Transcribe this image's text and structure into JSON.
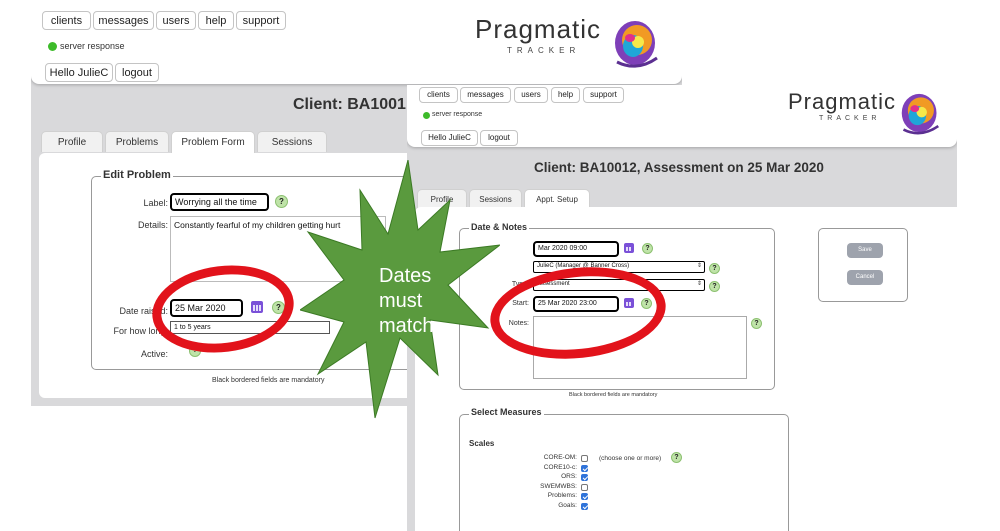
{
  "nav": {
    "clients": "clients",
    "messages": "messages",
    "users": "users",
    "help": "help",
    "support": "support",
    "hello": "Hello JulieC",
    "logout": "logout"
  },
  "status": {
    "server": "server response"
  },
  "logo": {
    "word": "Pragmatic",
    "sub": "TRACKER"
  },
  "win1": {
    "title": "Client: BA1001",
    "tabs": [
      "Profile",
      "Problems",
      "Problem Form",
      "Sessions"
    ],
    "legend": "Edit Problem",
    "label_label": "Label:",
    "label_value": "Worrying all the time",
    "details_label": "Details:",
    "details_value": "Constantly fearful of my children getting hurt",
    "date_label": "Date raised:",
    "date_value": "25 Mar 2020",
    "howlong_label": "For how long:",
    "howlong_value": "1 to 5 years",
    "active_label": "Active:",
    "mandatory": "Black bordered fields are mandatory"
  },
  "win2": {
    "title": "Client: BA10012, Assessment on 25 Mar 2020",
    "tabs": [
      "Profile",
      "Sessions",
      "Appt. Setup"
    ],
    "legend": "Date & Notes",
    "date_partial": "Mar 2020 09:00",
    "staff_value": "JulieC (Manager @ Banner Cross)",
    "type_label": "Type:",
    "type_value": "Assessment",
    "start_label": "Start:",
    "start_value": "25 Mar 2020 23:00",
    "notes_label": "Notes:",
    "save": "Save",
    "cancel": "Cancel",
    "mandatory": "Black bordered fields are mandatory",
    "measures_legend": "Select Measures",
    "scales_heading": "Scales",
    "choose_hint": "(choose one or more)",
    "measures": [
      {
        "label": "CORE-OM:",
        "checked": false
      },
      {
        "label": "CORE10-c:",
        "checked": true
      },
      {
        "label": "ORS:",
        "checked": true
      },
      {
        "label": "SWEMWBS:",
        "checked": false
      },
      {
        "label": "Problems:",
        "checked": true
      },
      {
        "label": "Goals:",
        "checked": true
      }
    ]
  },
  "callout": {
    "line1": "Dates",
    "line2": "must",
    "line3": "match"
  },
  "colors": {
    "callout": "#5a9a3e",
    "ring": "#e2131b",
    "status_dot": "#3dbb2a",
    "calendar": "#7a50d8",
    "checkbox": "#2f73d9"
  }
}
